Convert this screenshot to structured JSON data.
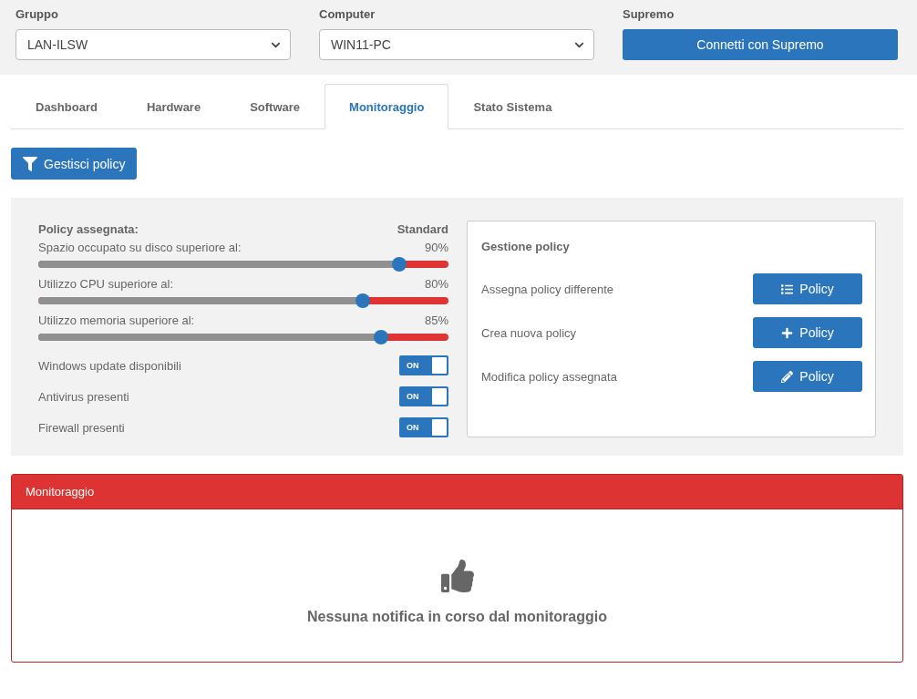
{
  "header": {
    "fields": [
      {
        "label": "Gruppo",
        "kind": "select",
        "value": "LAN-ILSW"
      },
      {
        "label": "Computer",
        "kind": "select",
        "value": "WIN11-PC"
      },
      {
        "label": "Supremo",
        "kind": "button",
        "value": "Connetti con Supremo"
      }
    ]
  },
  "tabs": [
    {
      "label": "Dashboard",
      "selected": false
    },
    {
      "label": "Hardware",
      "selected": false
    },
    {
      "label": "Software",
      "selected": false
    },
    {
      "label": "Monitoraggio",
      "selected": true
    },
    {
      "label": "Stato Sistema",
      "selected": false
    }
  ],
  "manage_button": "Gestisci policy",
  "policy": {
    "label": "Policy assegnata:",
    "value": "Standard",
    "thresholds": [
      {
        "label": "Spazio occupato su disco superiore al:",
        "reading": "90%",
        "level": 0.88
      },
      {
        "label": "Utilizzo CPU superiore al:",
        "reading": "80%",
        "level": 0.79
      },
      {
        "label": "Utilizzo memoria superiore al:",
        "reading": "85%",
        "level": 0.835
      }
    ],
    "switches": [
      {
        "label": "Windows update disponibili",
        "on": true,
        "text": "ON"
      },
      {
        "label": "Antivirus presenti",
        "on": true,
        "text": "ON"
      },
      {
        "label": "Firewall presenti",
        "on": true,
        "text": "ON"
      }
    ]
  },
  "management": {
    "title": "Gestione policy",
    "actions": [
      {
        "label": "Assegna policy differente",
        "button": "Policy",
        "kind": "list"
      },
      {
        "label": "Crea nuova policy",
        "button": "Policy",
        "kind": "plus"
      },
      {
        "label": "Modifica policy assegnata",
        "button": "Policy",
        "kind": "pencil"
      }
    ]
  },
  "monitor": {
    "title": "Monitoraggio",
    "message": "Nessuna notifica in corso dal monitoraggio"
  }
}
